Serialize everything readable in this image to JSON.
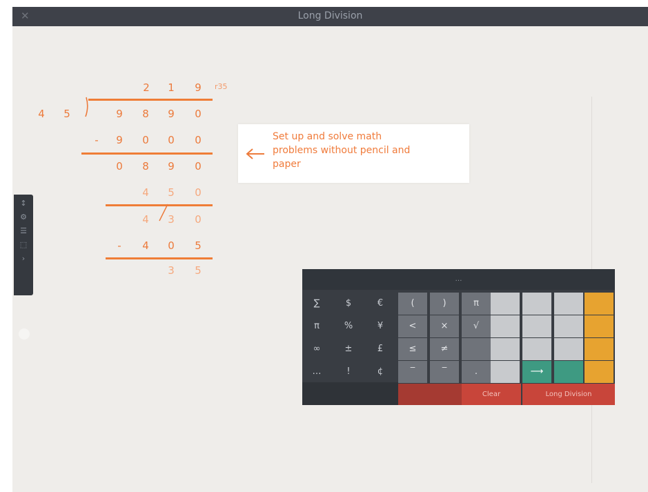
{
  "window": {
    "title": "Long Division",
    "close_symbol": "✕"
  },
  "division": {
    "quotient": [
      "2",
      "1",
      "9"
    ],
    "remainder_label": "r35",
    "divisor": [
      "4",
      "5"
    ],
    "dividend": [
      "9",
      "8",
      "9",
      "0"
    ],
    "row1": [
      "-",
      "9",
      "0",
      "0",
      "0"
    ],
    "row2": [
      "0",
      "8",
      "9",
      "0"
    ],
    "row3": [
      "4",
      "5",
      "0"
    ],
    "row4": [
      "4",
      "3",
      "0"
    ],
    "row5": [
      "-",
      "4",
      "0",
      "5"
    ],
    "row6": [
      "3",
      "5"
    ]
  },
  "callout": {
    "text": "Set up and solve math problems without pencil and paper"
  },
  "sidetab": {
    "items": [
      "↕",
      "⚙",
      "☰",
      "⬚",
      "›"
    ]
  },
  "keypad": {
    "header_left": "",
    "header_center": "…",
    "rows": [
      [
        "∑",
        "$",
        "€",
        "(",
        ")",
        "π",
        "",
        "",
        "",
        ""
      ],
      [
        "π",
        "%",
        "¥",
        "<",
        "×",
        "√",
        "",
        "",
        "",
        ""
      ],
      [
        "∞",
        "±",
        "£",
        "≤",
        "≠",
        "",
        "",
        "",
        "",
        ""
      ],
      [
        "…",
        "!",
        "¢",
        "‾",
        "‾",
        ".",
        "",
        "⟶",
        "",
        ""
      ]
    ],
    "footer": [
      "",
      "",
      "Clear",
      "Long Division"
    ]
  },
  "under_keypad_label": "",
  "colors": {
    "accent": "#ec7a3b",
    "titlebar": "#3e4149",
    "keypad_orange": "#e7a330",
    "keypad_teal": "#3e9a82",
    "keypad_red": "#c8453a"
  }
}
